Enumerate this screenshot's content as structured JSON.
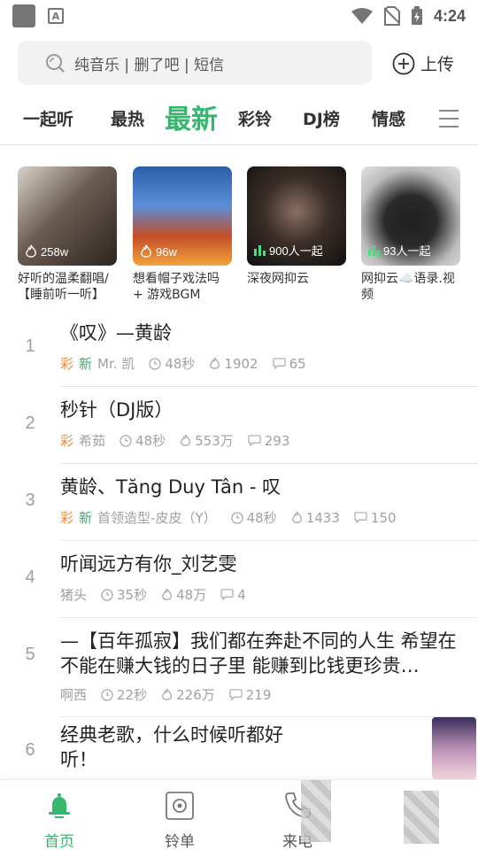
{
  "status_bar": {
    "time": "4:24"
  },
  "search": {
    "placeholder": "纯音乐 | 删了吧 | 短信",
    "upload_label": "上传"
  },
  "tabs": [
    {
      "label": "一起听"
    },
    {
      "label": "最热"
    },
    {
      "label": "最新",
      "active": true
    },
    {
      "label": "彩铃"
    },
    {
      "label": "DJ榜"
    },
    {
      "label": "情感"
    }
  ],
  "cards": [
    {
      "badge": "258w",
      "badge_icon": "fire-icon",
      "title": "好听的温柔翻唱/【睡前听一听】",
      "colors": [
        "#5a4a42",
        "#8e7f73"
      ]
    },
    {
      "badge": "96w",
      "badge_icon": "fire-icon",
      "title": "想看帽子戏法吗 + 游戏BGM",
      "colors": [
        "#2a5ea8",
        "#f2a33b"
      ]
    },
    {
      "badge": "900人一起",
      "badge_icon": "equalizer-icon",
      "title": "深夜网抑云",
      "colors": [
        "#1a1a1a",
        "#3a2e28"
      ]
    },
    {
      "badge": "93人一起",
      "badge_icon": "equalizer-icon",
      "title": "网抑云☁️语录.视频",
      "colors": [
        "#cfcfcf",
        "#2a2a2a"
      ]
    }
  ],
  "songs": [
    {
      "num": "1",
      "title": "《叹》—黄龄",
      "tag_c": "彩",
      "tag_x": "新",
      "artist": "Mr. 凯",
      "duration": "48秒",
      "plays": "1902",
      "comments": "65"
    },
    {
      "num": "2",
      "title": "秒针（DJ版）",
      "tag_c": "彩",
      "tag_x": "",
      "artist": "希茹",
      "duration": "48秒",
      "plays": "553万",
      "comments": "293"
    },
    {
      "num": "3",
      "title": "黄龄、Tăng Duy Tân - 叹",
      "tag_c": "彩",
      "tag_x": "新",
      "artist": "首领造型-皮皮（Y）",
      "duration": "48秒",
      "plays": "1433",
      "comments": "150"
    },
    {
      "num": "4",
      "title": "听闻远方有你_刘艺雯",
      "tag_c": "",
      "tag_x": "",
      "artist": "猪头",
      "duration": "35秒",
      "plays": "48万",
      "comments": "4"
    },
    {
      "num": "5",
      "title": "—【百年孤寂】我们都在奔赴不同的人生 希望在不能在赚大钱的日子里 能赚到比钱更珍贵…",
      "tag_c": "",
      "tag_x": "",
      "artist": "啊西",
      "duration": "22秒",
      "plays": "226万",
      "comments": "219"
    },
    {
      "num": "6",
      "title": "经典老歌，什么时候听都好听！",
      "tag_c": "",
      "tag_x": "",
      "artist": "",
      "duration": "",
      "plays": "",
      "comments": ""
    }
  ],
  "bottom_nav": [
    {
      "label": "首页",
      "icon": "bell-icon",
      "active": true
    },
    {
      "label": "铃单",
      "icon": "speaker-icon",
      "active": false
    },
    {
      "label": "来电",
      "icon": "phone-icon",
      "active": false
    },
    {
      "label": "",
      "icon": "profile-icon",
      "active": false
    }
  ],
  "accent_color": "#35b86e",
  "tag_colors": {
    "cai": "#f08a2e",
    "xin": "#2fb36c"
  }
}
